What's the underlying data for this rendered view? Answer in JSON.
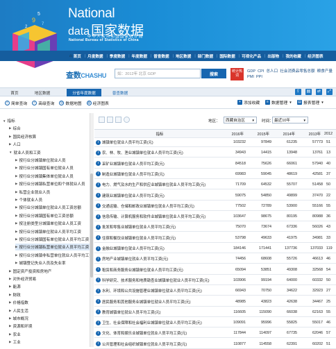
{
  "brand": {
    "en_top": "National",
    "en_data": "data",
    "cn_title": "国家数据",
    "sub_cn": "中华人民共和国国家统计局",
    "sub_en": "National Bureau of Statistics of China"
  },
  "nav": {
    "items": [
      "首页",
      "月度数据",
      "季度数据",
      "年度数据",
      "普查数据",
      "地区数据",
      "部门数据",
      "国际数据",
      "可视化产品",
      "出版物",
      "我的收藏",
      "经济图表"
    ],
    "separator": "|"
  },
  "search": {
    "logo_cn": "查数",
    "logo_en": "CHASHU",
    "placeholder": "如：2012年 北京 GDP",
    "button": "搜索",
    "tag": "统计热词",
    "hot_words": [
      "GDP",
      "CPI",
      "总人口",
      "社会消费品零售总额",
      "粮食产量",
      "PMI",
      "PPI"
    ]
  },
  "tabs": [
    "首页",
    "地区数据",
    "分省年度数据",
    "普查数据"
  ],
  "toolbar": {
    "left": [
      {
        "icon": "search-icon",
        "label": "简单查询"
      },
      {
        "icon": "advanced-search-icon",
        "label": "高级查询"
      },
      {
        "icon": "map-icon",
        "label": "数据地图"
      },
      {
        "icon": "chart-icon",
        "label": "经济图表"
      }
    ],
    "add_favorite": "添加收藏",
    "data_manage": "数据管理",
    "report_manage": "报表管理"
  },
  "filters": {
    "region_label": "地区：",
    "region_value": "西藏自治区",
    "time_label": "时间：",
    "time_value": "最近10年"
  },
  "sidebar": {
    "items": [
      {
        "label": "指标",
        "level": 0,
        "expanded": true
      },
      {
        "label": "综合",
        "level": 1
      },
      {
        "label": "国民经济核算",
        "level": 1
      },
      {
        "label": "人口",
        "level": 1
      },
      {
        "label": "就业人员和工资",
        "level": 1,
        "expanded": true
      },
      {
        "label": "按行业分城镇单位就业人员",
        "level": 2
      },
      {
        "label": "按行业分城镇国有单位就业人员",
        "level": 2
      },
      {
        "label": "按行业分城镇集体单位就业人员",
        "level": 2
      },
      {
        "label": "按行业分城镇私营单位和个体就业人员",
        "level": 2
      },
      {
        "label": "私营企业就业人员",
        "level": 2
      },
      {
        "label": "个体就业人员",
        "level": 2
      },
      {
        "label": "按行业分城镇单位就业人员工资总额",
        "level": 2
      },
      {
        "label": "按行业分城镇国有单位工资总额",
        "level": 2
      },
      {
        "label": "按注册类型分城镇单位就业人员工资",
        "level": 2
      },
      {
        "label": "按行业分城镇单位就业人员平均工资",
        "level": 2
      },
      {
        "label": "按行业分城镇国有单位就业人员平均工资",
        "level": 2
      },
      {
        "label": "按行业分城镇私营单位就业人员平均工资",
        "level": 2,
        "selected": true
      },
      {
        "label": "按行业分城镇非私营单位就业人员平均工资",
        "level": 2
      },
      {
        "label": "城镇登记失业人员及失业率",
        "level": 2
      },
      {
        "label": "固定资产投资和房地产",
        "level": 1
      },
      {
        "label": "对外经济贸易",
        "level": 1
      },
      {
        "label": "能源",
        "level": 1
      },
      {
        "label": "财政",
        "level": 1
      },
      {
        "label": "价格指数",
        "level": 1
      },
      {
        "label": "人民生活",
        "level": 1
      },
      {
        "label": "城市概况",
        "level": 1
      },
      {
        "label": "资源和环境",
        "level": 1
      },
      {
        "label": "农业",
        "level": 1
      },
      {
        "label": "工业",
        "level": 1
      },
      {
        "label": "建筑业",
        "level": 1
      }
    ]
  },
  "table": {
    "header_name": "指标",
    "years": [
      "2016年",
      "2015年",
      "2014年",
      "2013年",
      "2012"
    ],
    "rows": [
      {
        "name": "城镇单位就业人员平均工资(元)",
        "v": [
          "103232",
          "97849",
          "61235",
          "57773",
          "51"
        ]
      },
      {
        "name": "农、林、牧、渔业城镇单位就业人员平均工资(元)",
        "v": [
          "34943",
          "14415",
          "13948",
          "13761",
          "13"
        ]
      },
      {
        "name": "采矿业城镇单位就业人员平均工资(元)",
        "v": [
          "84518",
          "75626",
          "66061",
          "57940",
          "40"
        ]
      },
      {
        "name": "制造业城镇单位就业人员平均工资(元)",
        "v": [
          "69983",
          "59045",
          "48619",
          "42581",
          "37"
        ]
      },
      {
        "name": "电力、燃气及水的生产和供应业城镇单位就业人员平均工资(元)",
        "v": [
          "71709",
          "64532",
          "55707",
          "51458",
          "50"
        ]
      },
      {
        "name": "建筑业城镇单位就业人员平均工资(元)",
        "v": [
          "59075",
          "54850",
          "49899",
          "37470",
          "22"
        ]
      },
      {
        "name": "交通运输、仓储和邮政业城镇单位就业人员平均工资(元)",
        "v": [
          "77502",
          "72789",
          "53900",
          "55166",
          "55"
        ]
      },
      {
        "name": "信息传输、计算机服务和软件业城镇单位就业人员平均工资(元)",
        "v": [
          "103647",
          "98675",
          "80195",
          "80988",
          "36"
        ]
      },
      {
        "name": "批发和零售业城镇单位就业人员平均工资(元)",
        "v": [
          "75070",
          "73674",
          "67336",
          "56026",
          "43"
        ]
      },
      {
        "name": "住宿和餐饮业城镇单位就业人员平均工资(元)",
        "v": [
          "53798",
          "49633",
          "41975",
          "34981",
          "33"
        ]
      },
      {
        "name": "金融业城镇单位就业人员平均工资(元)",
        "v": [
          "184146",
          "171441",
          "137736",
          "137033",
          "119"
        ]
      },
      {
        "name": "房地产业城镇单位就业人员平均工资(元)",
        "v": [
          "74456",
          "68608",
          "55726",
          "46613",
          "46"
        ]
      },
      {
        "name": "租赁和商务服务业城镇单位就业人员平均工资(元)",
        "v": [
          "65094",
          "53851",
          "49308",
          "32568",
          "54"
        ]
      },
      {
        "name": "科学研究、技术服务和地质勘查业城镇单位就业人员平均工资(元)",
        "v": [
          "103906",
          "99194",
          "64000",
          "60332",
          "50"
        ]
      },
      {
        "name": "水利、环境和公共设施管理业城镇单位就业人员平均工资(元)",
        "v": [
          "66943",
          "70750",
          "34622",
          "32923",
          "27"
        ]
      },
      {
        "name": "居民服务和其他服务业城镇单位就业人员平均工资(元)",
        "v": [
          "48985",
          "43823",
          "42638",
          "34467",
          "25"
        ]
      },
      {
        "name": "教育城镇单位就业人员平均工资(元)",
        "v": [
          "116605",
          "115090",
          "66038",
          "62163",
          "55"
        ]
      },
      {
        "name": "卫生、社会保障和社会福利业城镇单位就业人员平均工资(元)",
        "v": [
          "109091",
          "95996",
          "55825",
          "55017",
          "46"
        ]
      },
      {
        "name": "文化、体育和娱乐业城镇单位就业人员平均工资(元)",
        "v": [
          "117844",
          "114097",
          "67735",
          "62046",
          "57"
        ]
      },
      {
        "name": "公共管理和社会组织城镇单位就业人员平均工资(元)",
        "v": [
          "110877",
          "114558",
          "62391",
          "60202",
          "51"
        ]
      }
    ]
  }
}
